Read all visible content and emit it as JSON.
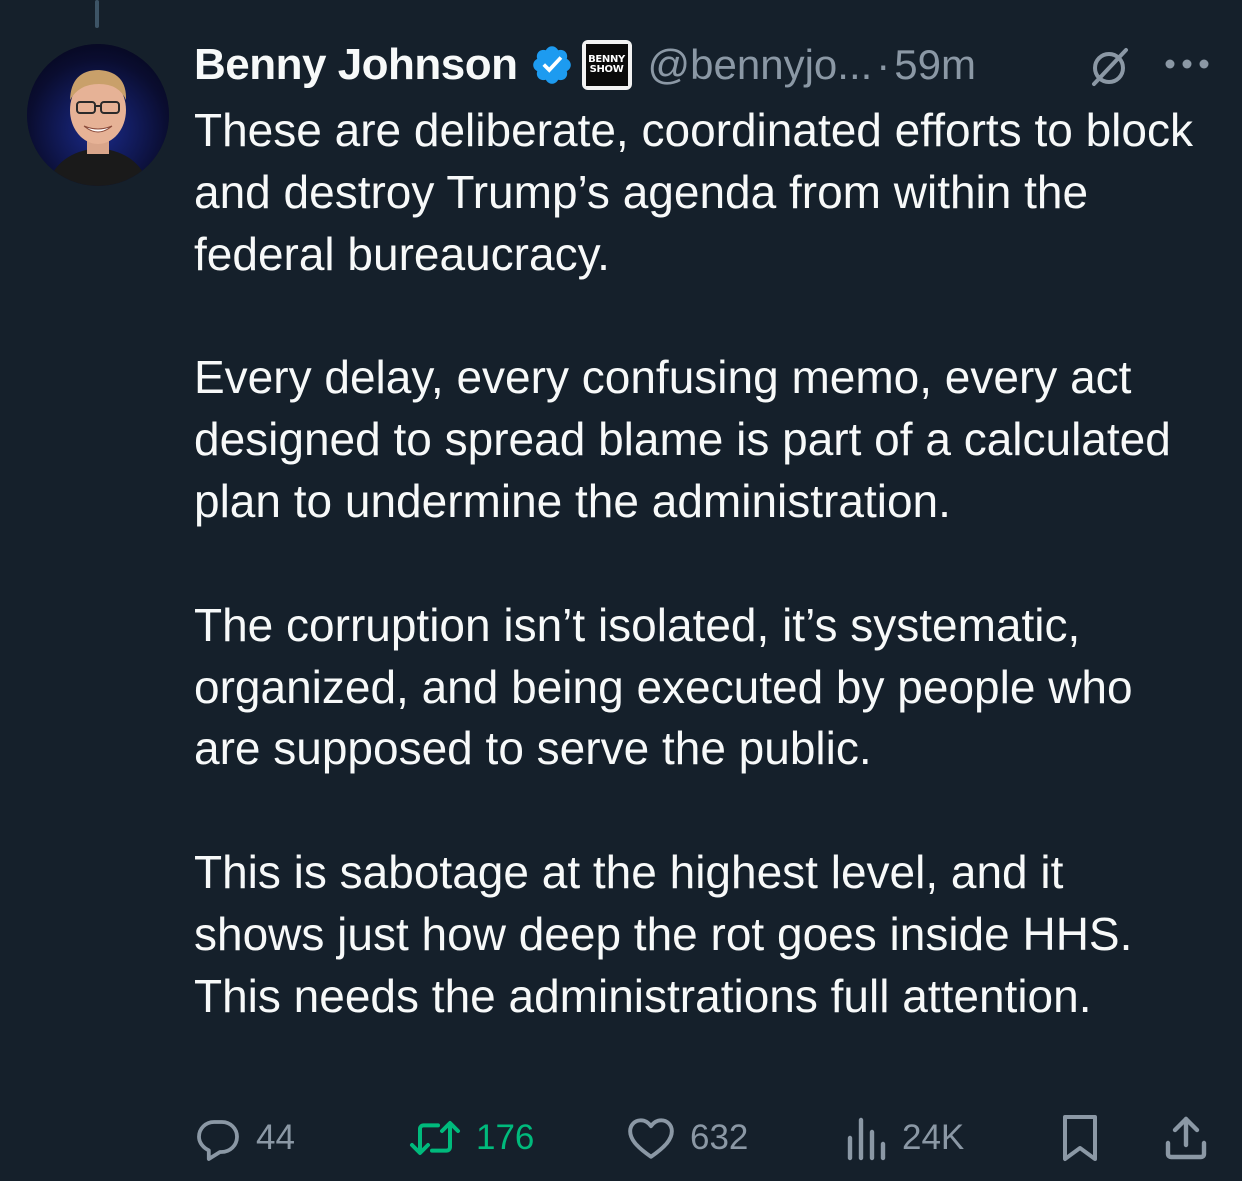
{
  "author": {
    "display_name": "Benny Johnson",
    "verified": true,
    "affiliation_badge": "BENNY SHOW",
    "handle": "@bennyjo...",
    "separator": "·",
    "time": "59m"
  },
  "tweet": {
    "paragraphs": [
      "These are deliberate, coordinated efforts to block and destroy Trump’s agenda from within the federal bureaucracy.",
      "Every delay, every confusing memo, every act designed to spread blame is part of a calculated plan to undermine the administration.",
      "The corruption isn’t isolated, it’s systematic, organized, and being executed by people who are supposed to serve the public.",
      "This is sabotage at the highest level, and it shows just how deep the rot goes inside HHS. This needs the administrations full attention."
    ]
  },
  "actions": {
    "replies": "44",
    "retweets": "176",
    "likes": "632",
    "views": "24K"
  },
  "icons": {
    "reply": "speech-bubble-icon",
    "retweet": "retweet-arrows-icon",
    "like": "heart-icon",
    "views": "bar-chart-icon",
    "bookmark": "bookmark-icon",
    "share": "share-upload-icon",
    "grok": "grok-slash-circle-icon",
    "more": "three-dots-icon",
    "verified": "verified-badge-icon"
  },
  "colors": {
    "background": "#15202b",
    "text_primary": "#f7f9f9",
    "text_secondary": "#8b98a5",
    "verified_blue": "#1d9bf0",
    "retweet_green": "#00ba7c"
  }
}
